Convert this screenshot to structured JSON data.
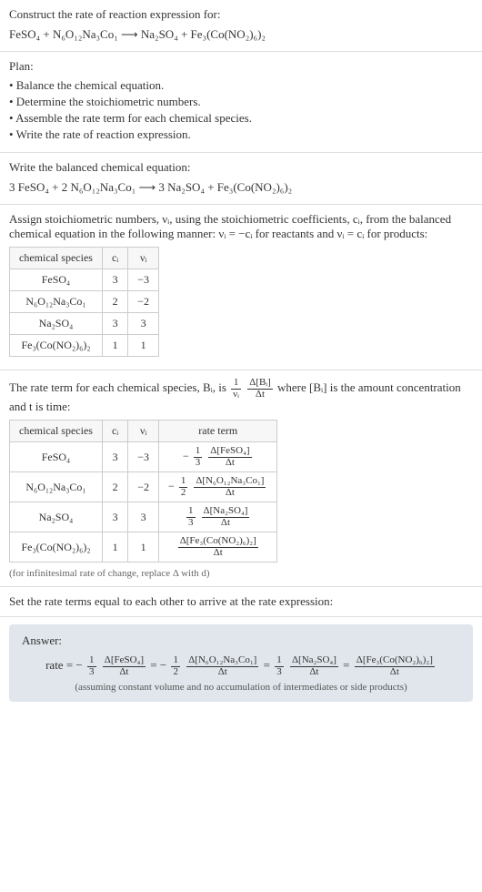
{
  "intro": {
    "heading": "Construct the rate of reaction expression for:",
    "equation": "FeSO₄ + N₆O₁₂Na₃Co₁ ⟶ Na₂SO₄ + Fe₃(Co(NO₂)₆)₂"
  },
  "plan": {
    "heading": "Plan:",
    "items": [
      "• Balance the chemical equation.",
      "• Determine the stoichiometric numbers.",
      "• Assemble the rate term for each chemical species.",
      "• Write the rate of reaction expression."
    ]
  },
  "balanced": {
    "heading": "Write the balanced chemical equation:",
    "equation": "3 FeSO₄ + 2 N₆O₁₂Na₃Co₁ ⟶ 3 Na₂SO₄ + Fe₃(Co(NO₂)₆)₂"
  },
  "stoich": {
    "text_a": "Assign stoichiometric numbers, νᵢ, using the stoichiometric coefficients, cᵢ, from the balanced chemical equation in the following manner: νᵢ = −cᵢ for reactants and νᵢ = cᵢ for products:",
    "table": {
      "headers": [
        "chemical species",
        "cᵢ",
        "νᵢ"
      ],
      "rows": [
        [
          "FeSO₄",
          "3",
          "−3"
        ],
        [
          "N₆O₁₂Na₃Co₁",
          "2",
          "−2"
        ],
        [
          "Na₂SO₄",
          "3",
          "3"
        ],
        [
          "Fe₃(Co(NO₂)₆)₂",
          "1",
          "1"
        ]
      ]
    }
  },
  "rate_term": {
    "text_a": "The rate term for each chemical species, Bᵢ, is",
    "frac_outer_num": "1",
    "frac_outer_den": "νᵢ",
    "frac_inner_num": "Δ[Bᵢ]",
    "frac_inner_den": "Δt",
    "text_b": "where [Bᵢ] is the amount concentration and t is time:",
    "table": {
      "headers": [
        "chemical species",
        "cᵢ",
        "νᵢ",
        "rate term"
      ]
    },
    "rows": [
      {
        "species": "FeSO₄",
        "c": "3",
        "nu": "−3",
        "sign": "−",
        "coef_num": "1",
        "coef_den": "3",
        "d_num": "Δ[FeSO₄]",
        "d_den": "Δt"
      },
      {
        "species": "N₆O₁₂Na₃Co₁",
        "c": "2",
        "nu": "−2",
        "sign": "−",
        "coef_num": "1",
        "coef_den": "2",
        "d_num": "Δ[N₆O₁₂Na₃Co₁]",
        "d_den": "Δt"
      },
      {
        "species": "Na₂SO₄",
        "c": "3",
        "nu": "3",
        "sign": "",
        "coef_num": "1",
        "coef_den": "3",
        "d_num": "Δ[Na₂SO₄]",
        "d_den": "Δt"
      },
      {
        "species": "Fe₃(Co(NO₂)₆)₂",
        "c": "1",
        "nu": "1",
        "sign": "",
        "coef_num": "",
        "coef_den": "",
        "d_num": "Δ[Fe₃(Co(NO₂)₆)₂]",
        "d_den": "Δt"
      }
    ],
    "footnote": "(for infinitesimal rate of change, replace Δ with d)"
  },
  "set_equal": {
    "text": "Set the rate terms equal to each other to arrive at the rate expression:"
  },
  "answer": {
    "title": "Answer:",
    "prefix": "rate =",
    "terms": [
      {
        "sign": "−",
        "coef_num": "1",
        "coef_den": "3",
        "d_num": "Δ[FeSO₄]",
        "d_den": "Δt"
      },
      {
        "sign": "= −",
        "coef_num": "1",
        "coef_den": "2",
        "d_num": "Δ[N₆O₁₂Na₃Co₁]",
        "d_den": "Δt"
      },
      {
        "sign": "=",
        "coef_num": "1",
        "coef_den": "3",
        "d_num": "Δ[Na₂SO₄]",
        "d_den": "Δt"
      },
      {
        "sign": "=",
        "coef_num": "",
        "coef_den": "",
        "d_num": "Δ[Fe₃(Co(NO₂)₆)₂]",
        "d_den": "Δt"
      }
    ],
    "note": "(assuming constant volume and no accumulation of intermediates or side products)"
  }
}
